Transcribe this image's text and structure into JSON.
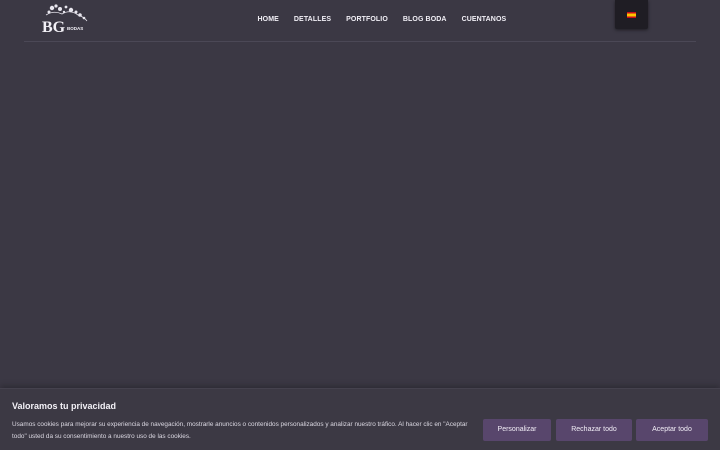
{
  "header": {
    "logo_letters": "BG",
    "logo_sub": "BODAS",
    "nav": [
      "HOME",
      "DETALLES",
      "PORTFOLIO",
      "BLOG BODA",
      "CUENTANOS"
    ]
  },
  "language": {
    "flag_icon": "spain-flag-icon"
  },
  "cookie": {
    "title": "Valoramos tu privacidad",
    "text": "Usamos cookies para mejorar su experiencia de navegación, mostrarle anuncios o contenidos personalizados y analizar nuestro tráfico. Al hacer clic en \"Aceptar todo\" usted da su consentimiento a nuestro uso de las cookies.",
    "buttons": {
      "customize": "Personalizar",
      "reject": "Rechazar todo",
      "accept": "Aceptar todo"
    }
  },
  "colors": {
    "background": "#3b3844",
    "button": "#58466c",
    "text": "#f1eff6"
  }
}
